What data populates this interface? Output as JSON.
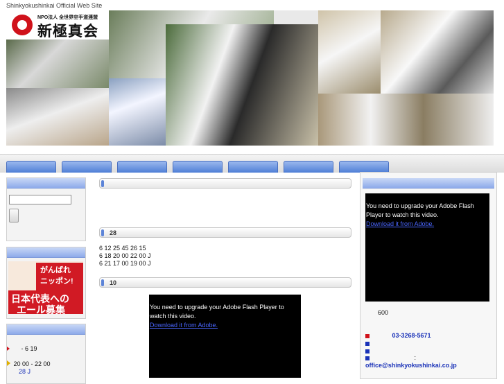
{
  "site_tagline": "Shinkyokushinkai Official Web Site",
  "logo": {
    "small": "NPO法人 全世界空手道連盟",
    "big": "新極真会"
  },
  "search": {
    "placeholder": ""
  },
  "ad": {
    "line1": "がんばれ",
    "line2": "ニッポン!",
    "line3": "日本代表への",
    "line4": "エール募集"
  },
  "sections": [
    {
      "label": ""
    },
    {
      "label": "28"
    },
    {
      "label": "10"
    }
  ],
  "schedule": [
    "6 12    25 45 26 15",
    "6 18    20 00 22 00 J",
    "6 21    17 00 19 00 J"
  ],
  "left_news": [
    {
      "text": "- 6 19"
    },
    {
      "text": "20 00 - 22 00"
    },
    {
      "text": "28      J"
    },
    {
      "text": ""
    }
  ],
  "flash_center": {
    "message": "You need to upgrade your Adobe Flash Player to watch this video.",
    "link": "Download it from Adobe."
  },
  "flash_right": {
    "message": "You need to upgrade your Adobe Flash Player to watch this video.",
    "link": "Download it from Adobe."
  },
  "contact": {
    "line1": "600",
    "phone": "03-3268-5671",
    "email_label": ":",
    "email": "office@shinkyokushinkai.co.jp"
  }
}
